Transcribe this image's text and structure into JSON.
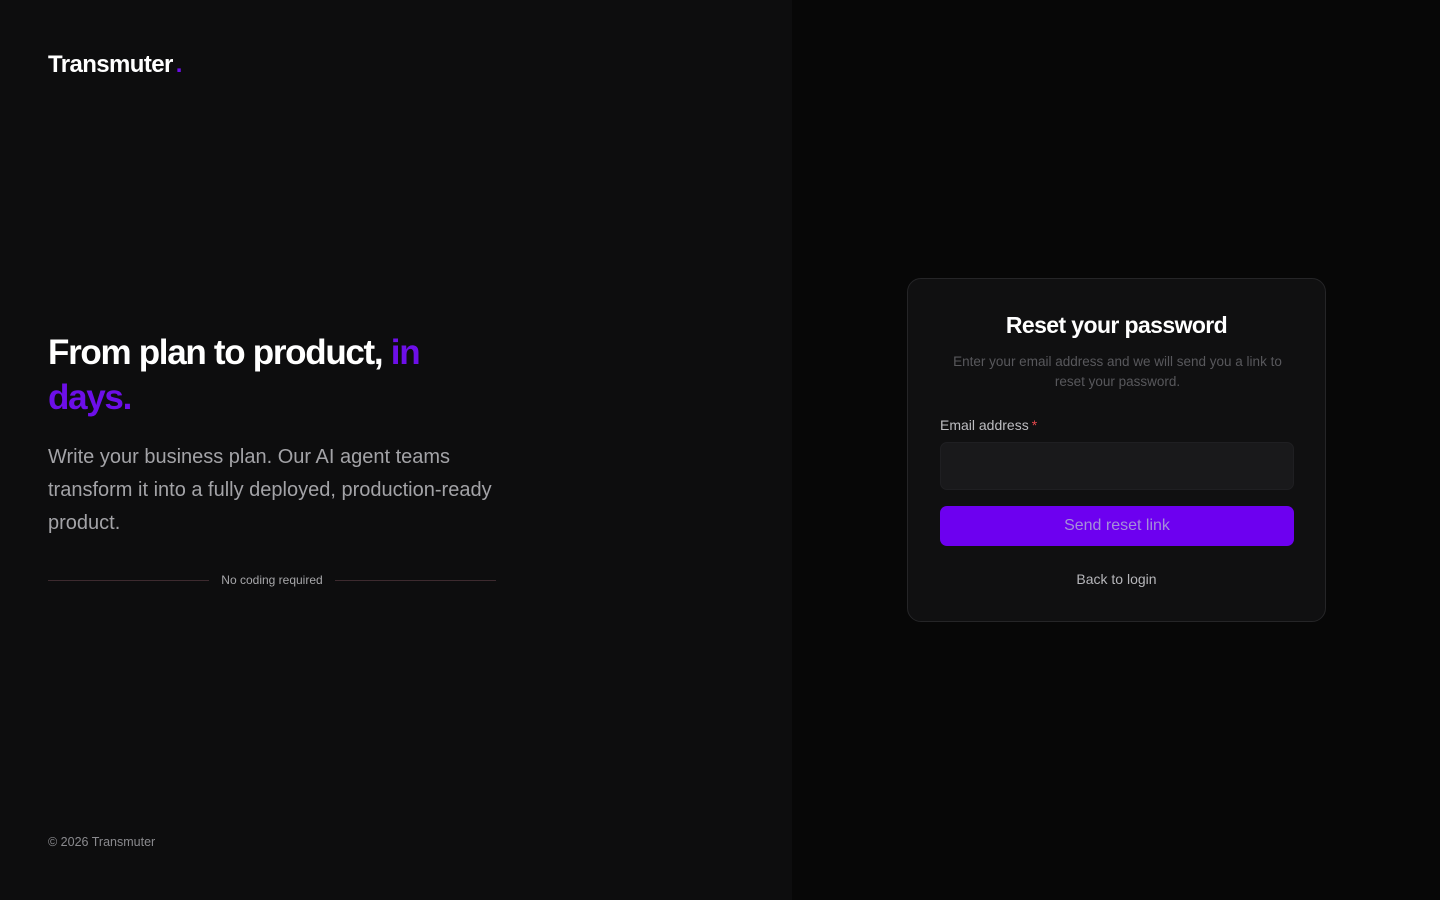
{
  "brand": {
    "name": "Transmuter",
    "dot": ".",
    "accent_color": "#6d0fe8"
  },
  "hero": {
    "headline_main": "From plan to product,",
    "headline_accent": "in days.",
    "description": "Write your business plan. Our AI agent teams transform it into a fully deployed, production-ready product.",
    "divider_text": "No coding required"
  },
  "footer": {
    "copyright": "© 2026 Transmuter"
  },
  "reset_form": {
    "title": "Reset your password",
    "subtitle": "Enter your email address and we will send you a link to reset your password.",
    "email_label": "Email address",
    "required_marker": "*",
    "email_value": "",
    "email_placeholder": "",
    "submit_label": "Send reset link",
    "back_link_label": "Back to login",
    "button_color": "#6d00f0"
  }
}
